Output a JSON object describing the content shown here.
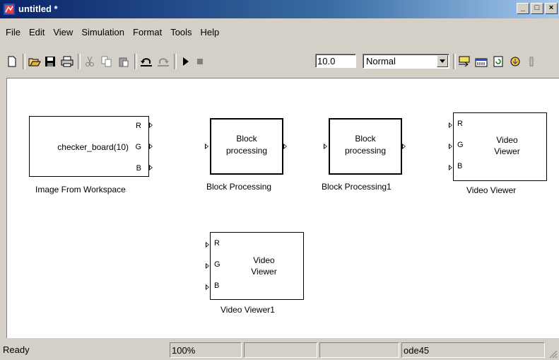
{
  "window": {
    "title": "untitled *"
  },
  "menu": [
    "File",
    "Edit",
    "View",
    "Simulation",
    "Format",
    "Tools",
    "Help"
  ],
  "toolbar": {
    "stop_time": "10.0",
    "sim_mode": "Normal"
  },
  "blocks": {
    "image_from_workspace": {
      "text": "checker_board(10)",
      "caption": "Image From Workspace",
      "ports": [
        "R",
        "G",
        "B"
      ]
    },
    "block_processing": {
      "line1": "Block",
      "line2": "processing",
      "caption": "Block Processing"
    },
    "block_processing1": {
      "line1": "Block",
      "line2": "processing",
      "caption": "Block Processing1"
    },
    "video_viewer": {
      "line1": "Video",
      "line2": "Viewer",
      "caption": "Video Viewer",
      "ports": [
        "R",
        "G",
        "B"
      ]
    },
    "video_viewer1": {
      "line1": "Video",
      "line2": "Viewer",
      "caption": "Video Viewer1",
      "ports": [
        "R",
        "G",
        "B"
      ]
    }
  },
  "status": {
    "state": "Ready",
    "zoom": "100%",
    "solver": "ode45"
  }
}
